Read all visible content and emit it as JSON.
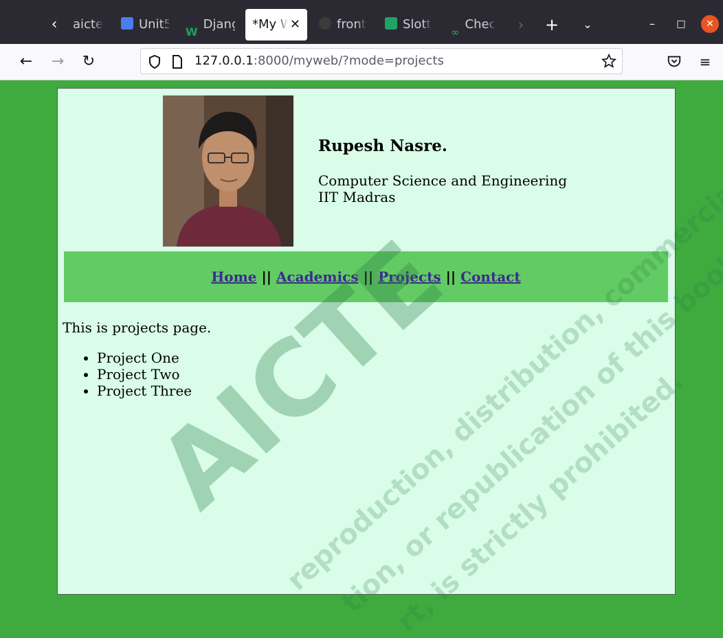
{
  "browser": {
    "tabs": [
      {
        "label": "aicte",
        "icon": "aicte-icon",
        "color": "#cfcfd8"
      },
      {
        "label": "Unit5",
        "icon": "docs-icon",
        "color": "#4c7cf0"
      },
      {
        "label": "Django",
        "icon": "w-logo-icon",
        "color": "#1aa260"
      },
      {
        "label": "*My Web",
        "icon": "",
        "color": ""
      },
      {
        "label": "front",
        "icon": "github-icon",
        "color": "#3b3b3b"
      },
      {
        "label": "Slott",
        "icon": "sheets-icon",
        "color": "#1fa463"
      },
      {
        "label": "Chec",
        "icon": "link-icon",
        "color": "#2ea85a"
      }
    ],
    "url_host": "127.0.0.1",
    "url_rest": ":8000/myweb/?mode=projects"
  },
  "profile": {
    "name": "Rupesh Nasre.",
    "dept_line1": "Computer Science and Engineering",
    "dept_line2": "IIT Madras"
  },
  "menu": {
    "home": "Home",
    "academics": "Academics",
    "projects": "Projects",
    "contact": "Contact",
    "separator": "||"
  },
  "content": {
    "intro": "This is projects page.",
    "projects": [
      "Project One",
      "Project Two",
      "Project Three"
    ]
  },
  "watermark": {
    "big": "AICTE",
    "line1": "reproduction, distribution, commercial",
    "line2": "tion, or republication of this book",
    "line3": "rt, is strictly prohibited."
  },
  "colors": {
    "page_bg": "#3fab3f",
    "content_bg": "#d9fde8",
    "menu_bg": "#63cb63",
    "link": "#3b2b91"
  }
}
